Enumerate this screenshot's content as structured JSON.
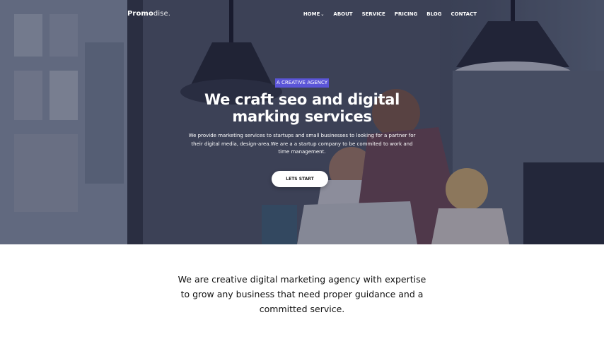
{
  "brand": {
    "logo_bold": "Promo",
    "logo_light": "dise."
  },
  "nav": {
    "items": [
      {
        "label": "HOME",
        "has_dropdown": true
      },
      {
        "label": "ABOUT"
      },
      {
        "label": "SERVICE"
      },
      {
        "label": "PRICING"
      },
      {
        "label": "BLOG"
      },
      {
        "label": "CONTACT"
      }
    ],
    "dropdown_icon": "chevron-down-icon"
  },
  "hero": {
    "tag": "A CREATIVE AGENCY",
    "headline_line1": "We craft seo and digital",
    "headline_line2": "marking services",
    "subtext": "We provide marketing services to startups and small businesses to looking for a partner for their digital media, design-area.We are a a startup company to be commited to work and time management.",
    "cta_label": "LETS START",
    "background_image": "team-working-at-laptop-photo"
  },
  "intro": {
    "text": "We are creative digital marketing agency with expertise to grow any business that need proper guidance and a committed service."
  },
  "colors": {
    "accent": "#5b55d8",
    "overlay": "#12142d",
    "text_dark": "#111111",
    "white": "#ffffff"
  }
}
